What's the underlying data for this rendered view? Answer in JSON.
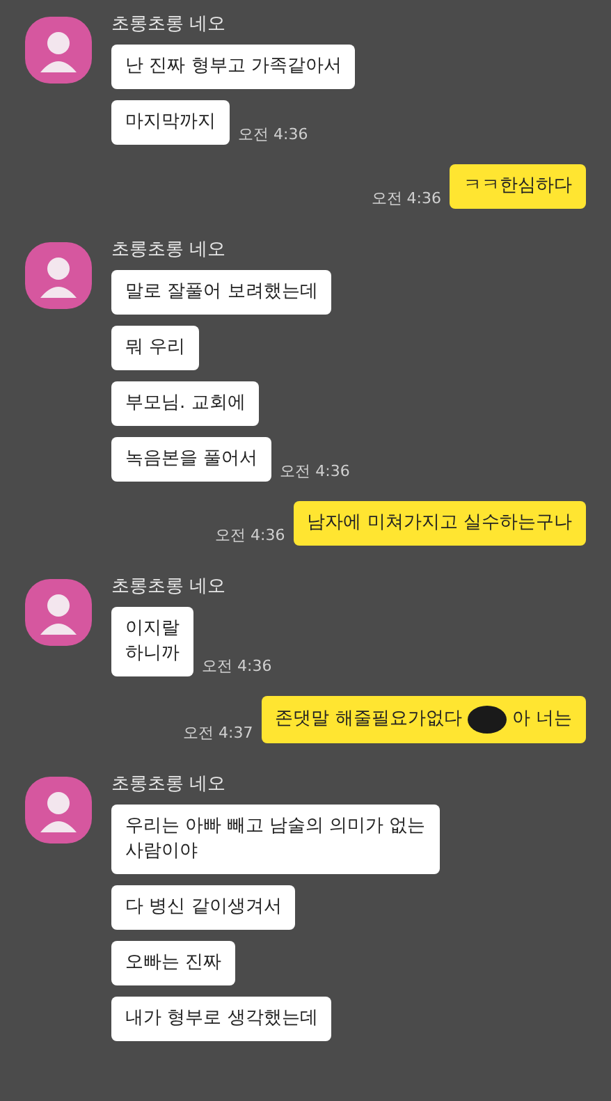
{
  "messages": [
    {
      "kind": "received",
      "sender": "초롱초롱 네오",
      "bubbles": [
        "난 진짜 형부고 가족같아서",
        "마지막까지"
      ],
      "time": "오전 4:36"
    },
    {
      "kind": "sent",
      "text": "ㅋㅋ한심하다",
      "time": "오전 4:36"
    },
    {
      "kind": "received",
      "sender": "초롱초롱 네오",
      "bubbles": [
        "말로 잘풀어 보려했는데",
        "뭐 우리",
        "부모님. 교회에",
        "녹음본을 풀어서"
      ],
      "time": "오전 4:36"
    },
    {
      "kind": "sent",
      "text": "남자에 미쳐가지고 실수하는구나",
      "time": "오전 4:36"
    },
    {
      "kind": "received",
      "sender": "초롱초롱 네오",
      "bubbles": [
        "이지랄\n하니까"
      ],
      "time": "오전 4:36"
    },
    {
      "kind": "sent",
      "text": "존댓말 해줄필요가없다",
      "redacted": true,
      "text_after": "아 너는",
      "time": "오전 4:37"
    },
    {
      "kind": "received",
      "sender": "초롱초롱 네오",
      "bubbles": [
        "우리는 아빠 빼고 남술의 의미가 없는\n사람이야",
        "다 병신 같이생겨서",
        "오빠는 진짜",
        "내가 형부로 생각했는데"
      ]
    }
  ]
}
